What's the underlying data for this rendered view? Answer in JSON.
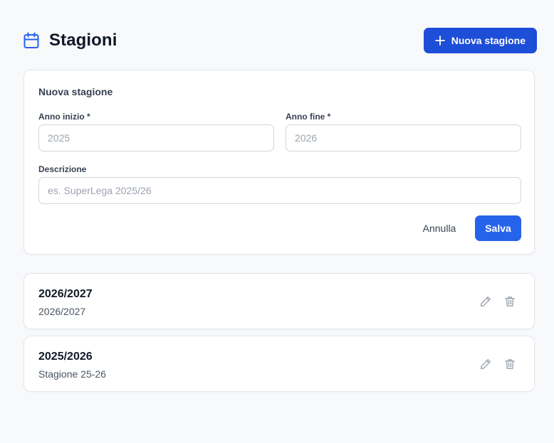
{
  "header": {
    "title": "Stagioni",
    "icon": "calendar-icon",
    "new_button_label": "Nuova stagione",
    "new_button_icon": "plus-icon"
  },
  "form": {
    "title": "Nuova stagione",
    "start_year": {
      "label": "Anno inizio *",
      "placeholder": "2025",
      "value": ""
    },
    "end_year": {
      "label": "Anno fine *",
      "placeholder": "2026",
      "value": ""
    },
    "description": {
      "label": "Descrizione",
      "placeholder": "es. SuperLega 2025/26",
      "value": ""
    },
    "cancel_label": "Annulla",
    "save_label": "Salva"
  },
  "seasons": [
    {
      "name": "2026/2027",
      "description": "2026/2027",
      "edit_icon": "pencil-icon",
      "delete_icon": "trash-icon"
    },
    {
      "name": "2025/2026",
      "description": "Stagione 25-26",
      "edit_icon": "pencil-icon",
      "delete_icon": "trash-icon"
    }
  ],
  "colors": {
    "accent": "#1d4ed8",
    "save_button": "#2563eb",
    "background": "#f8f9fb",
    "icon_muted": "#9ca3af"
  }
}
